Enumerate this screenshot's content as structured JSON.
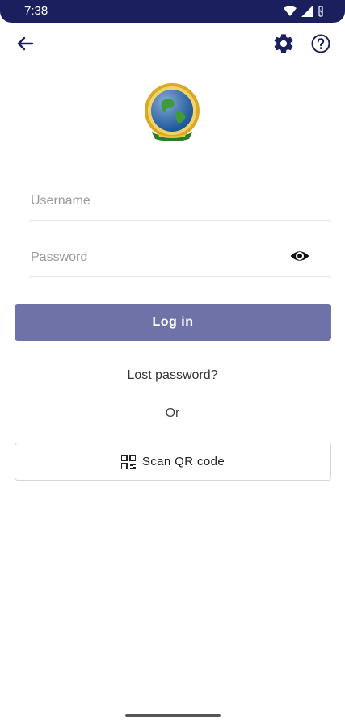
{
  "status": {
    "time": "7:38"
  },
  "form": {
    "username_placeholder": "Username",
    "password_placeholder": "Password",
    "login_label": "Log in",
    "lost_password": "Lost password?",
    "or_text": "Or",
    "scan_label": "Scan QR code"
  },
  "colors": {
    "status_bar": "#1b1f5e",
    "primary_button": "#6e72a6",
    "icon": "#1b1f5e"
  },
  "icons": [
    "back-arrow-icon",
    "gear-icon",
    "help-icon",
    "globe-badge-logo",
    "eye-icon",
    "qr-code-icon"
  ]
}
